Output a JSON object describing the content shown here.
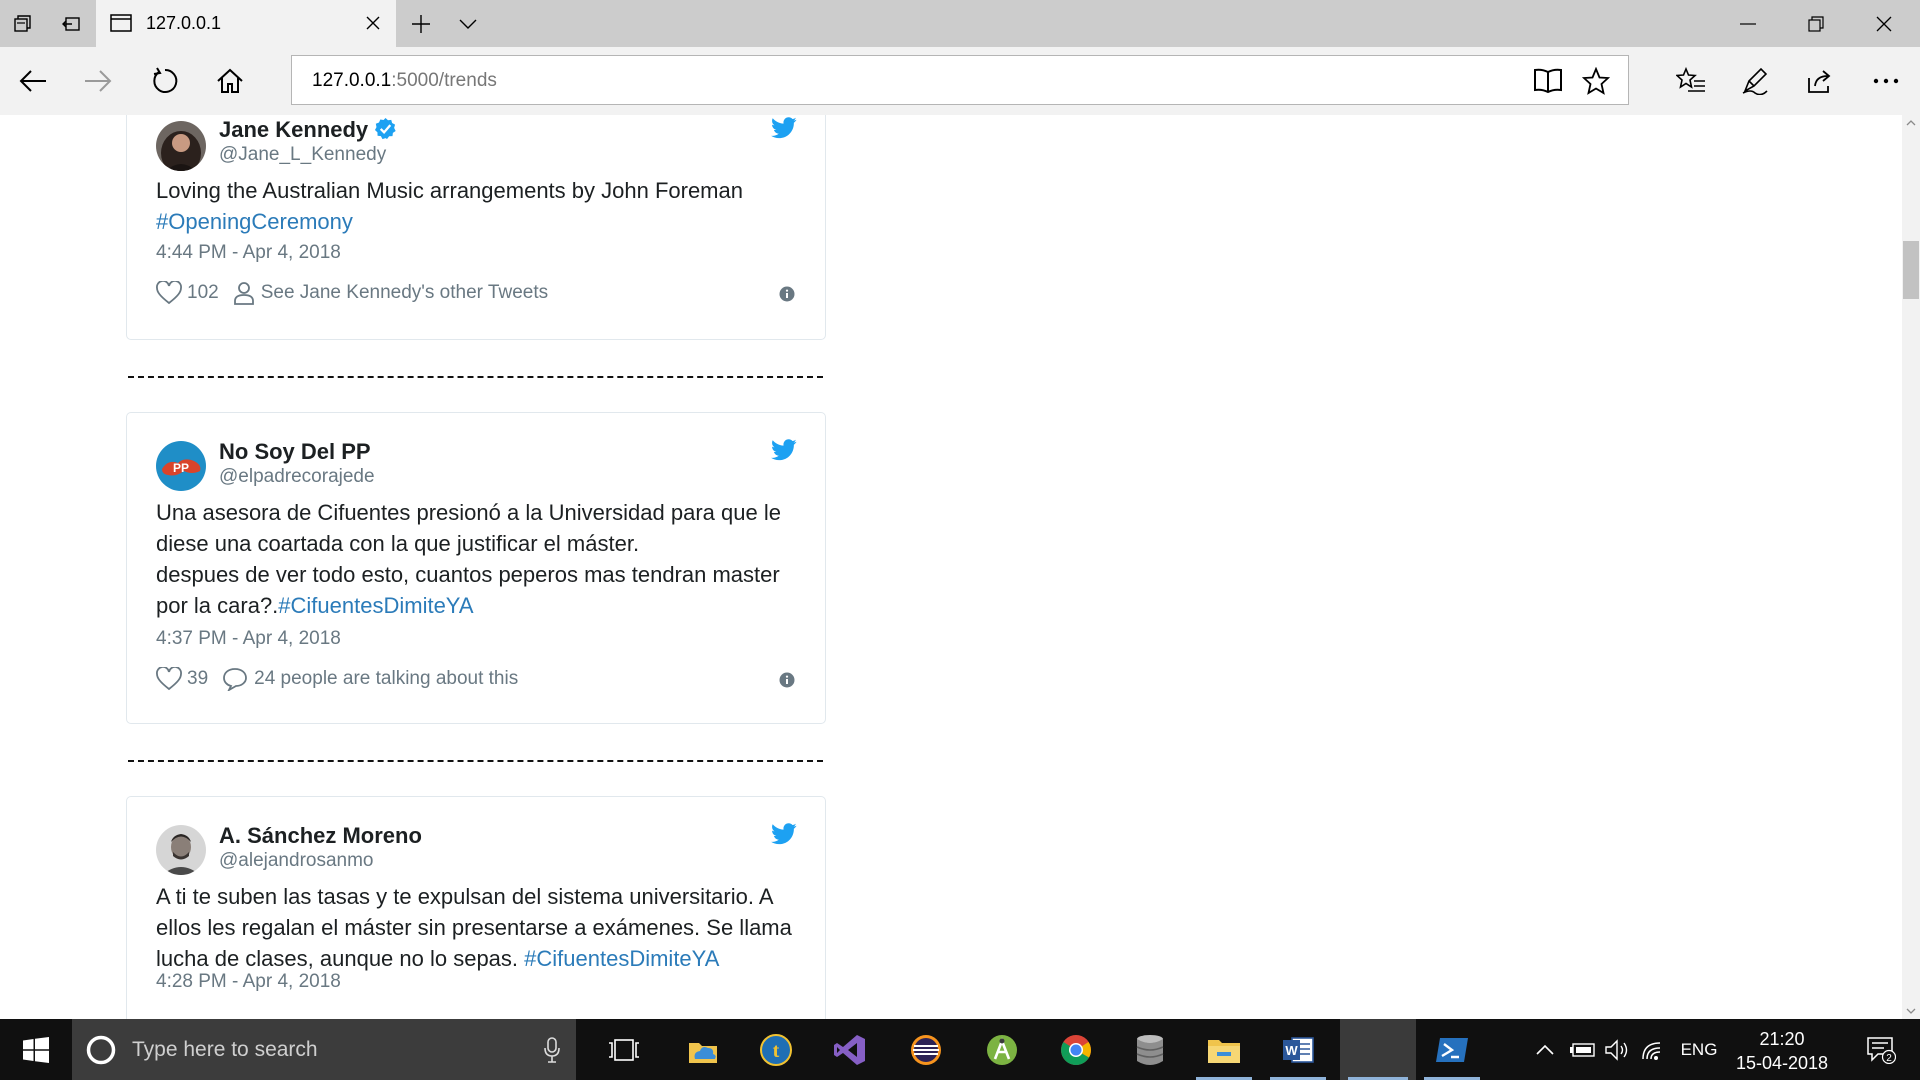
{
  "browser": {
    "tab_title": "127.0.0.1",
    "url_host": "127.0.0.1",
    "url_path": ":5000/trends"
  },
  "tweets": [
    {
      "name": "Jane Kennedy",
      "verified": true,
      "handle": "@Jane_L_Kennedy",
      "text_parts": [
        "Loving the Australian Music arrangements by John Foreman "
      ],
      "hashtag": "#OpeningCeremony",
      "timestamp": "4:44 PM - Apr 4, 2018",
      "likes": "102",
      "meta_text": "See Jane Kennedy's other Tweets"
    },
    {
      "name": "No Soy Del PP",
      "handle": "@elpadrecorajede",
      "text_line1": "Una asesora de Cifuentes presionó a la Universidad para que le diese una coartada con la que justificar el máster.",
      "text_line2": "despues de ver todo esto, cuantos peperos mas tendran master por la cara?.",
      "hashtag": "#CifuentesDimiteYA",
      "timestamp": "4:37 PM - Apr 4, 2018",
      "likes": "39",
      "meta_text": "24 people are talking about this"
    },
    {
      "name": "A. Sánchez Moreno",
      "handle": "@alejandrosanmo",
      "text": "A ti te suben las tasas y te expulsan del sistema universitario. A ellos les regalan el máster sin presentarse a exámenes. Se llama lucha de clases, aunque no lo sepas. ",
      "hashtag": "#CifuentesDimiteYA",
      "timestamp": "4:28 PM - Apr 4, 2018"
    }
  ],
  "taskbar": {
    "search_placeholder": "Type here to search",
    "language": "ENG",
    "time": "21:20",
    "date": "15-04-2018",
    "notification_count": "2"
  },
  "colors": {
    "twitter_blue": "#1da1f2",
    "hashtag": "#2b7bb9",
    "meta_gray": "#697882"
  }
}
